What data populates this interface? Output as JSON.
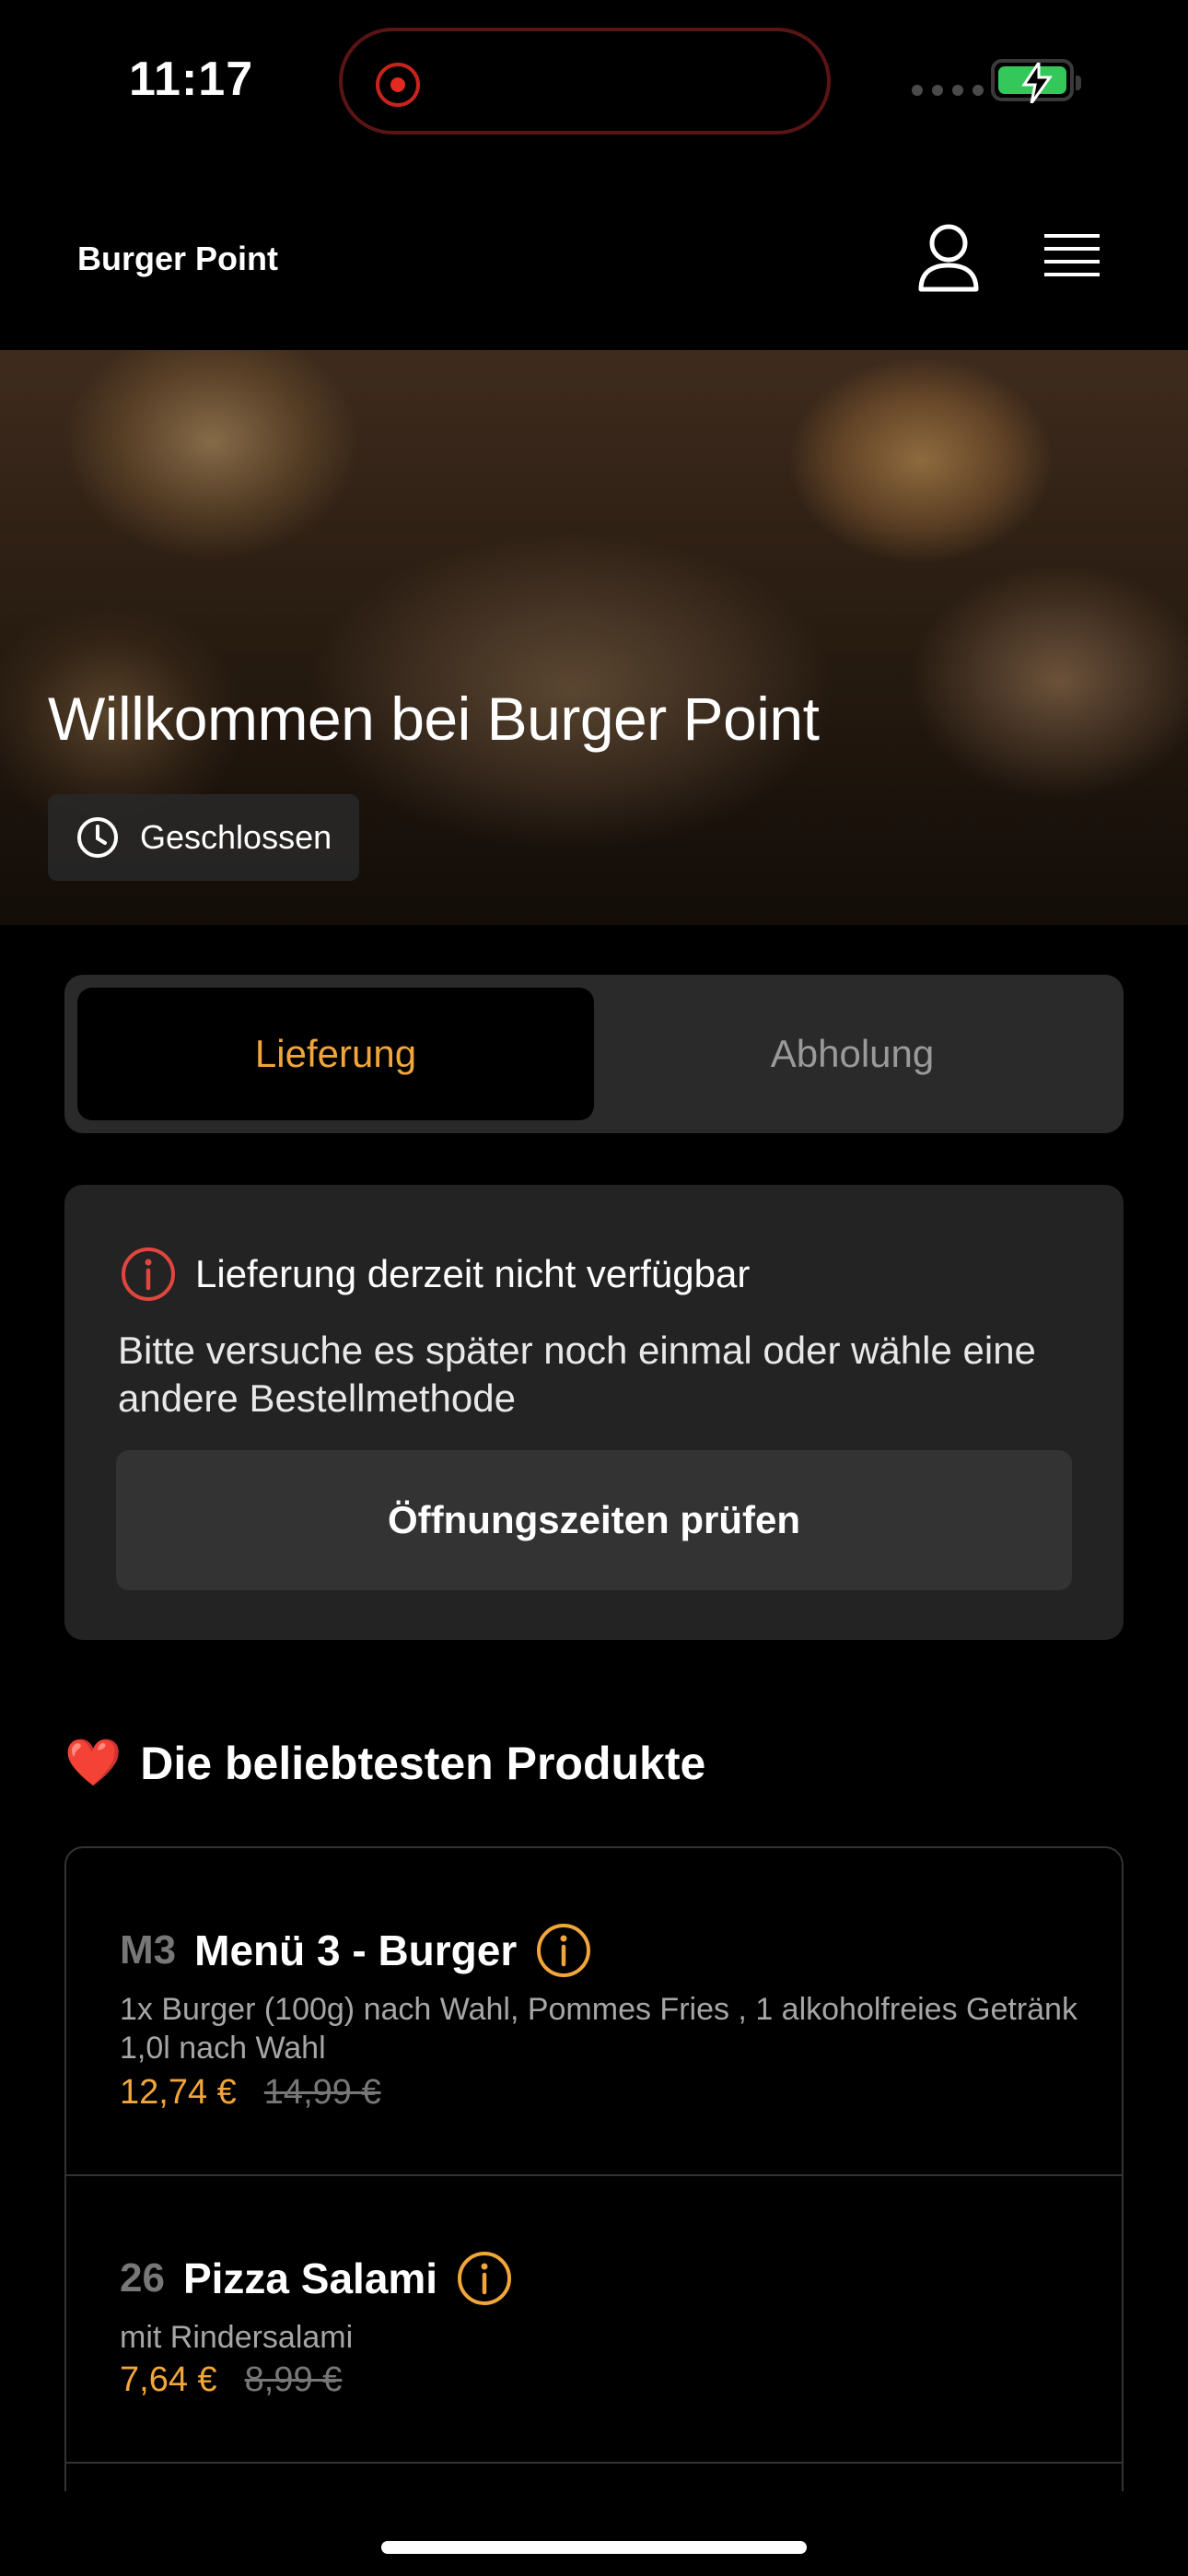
{
  "status_bar": {
    "time": "11:17"
  },
  "header": {
    "brand": "Burger Point"
  },
  "hero": {
    "title": "Willkommen bei Burger Point",
    "status": "Geschlossen"
  },
  "tabs": [
    {
      "label": "Lieferung",
      "active": true
    },
    {
      "label": "Abholung",
      "active": false
    }
  ],
  "notice": {
    "title": "Lieferung derzeit nicht verfügbar",
    "text": "Bitte versuche es später noch einmal oder wähle eine andere Bestellmethode",
    "button": "Öffnungszeiten prüfen"
  },
  "section": {
    "emoji": "❤️",
    "title": "Die beliebtesten Produkte"
  },
  "products": [
    {
      "code": "M3",
      "name": "Menü 3 - Burger",
      "description": "1x Burger (100g) nach Wahl, Pommes Fries , 1 alkoholfreies Getränk 1,0l nach Wahl",
      "price": "12,74 €",
      "old_price": "14,99 €"
    },
    {
      "code": "26",
      "name": "Pizza Salami",
      "description": "mit Rindersalami",
      "price": "7,64 €",
      "old_price": "8,99 €"
    }
  ],
  "colors": {
    "accent": "#f0a63a",
    "alert": "#e0463e",
    "background": "#000000",
    "card": "#232323"
  }
}
